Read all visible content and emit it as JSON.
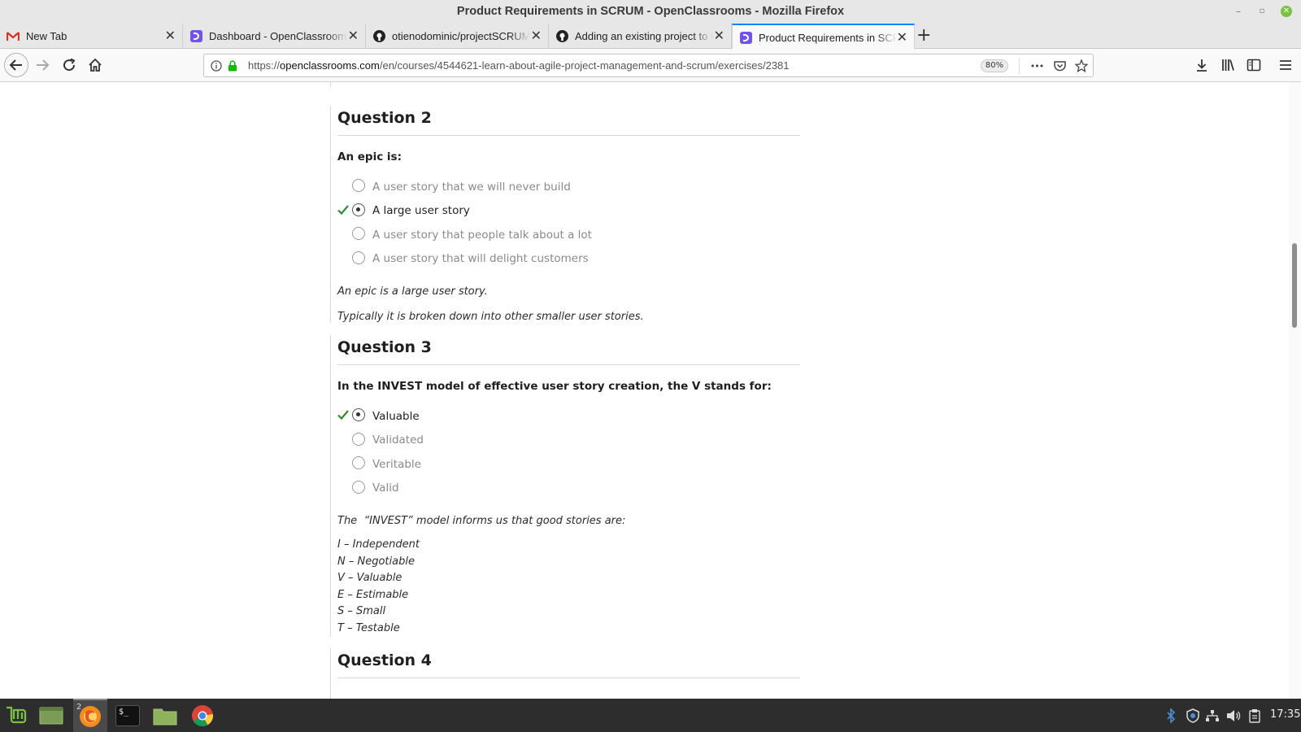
{
  "window": {
    "title": "Product Requirements in SCRUM - OpenClassrooms - Mozilla Firefox",
    "controls": {
      "minimize": "–",
      "maximize": "▫",
      "close": "✕"
    }
  },
  "tabs": [
    {
      "label": "New Tab",
      "icon": "gmail-icon",
      "active": false
    },
    {
      "label": "Dashboard - OpenClassrooms",
      "icon": "openclassrooms-icon",
      "active": false
    },
    {
      "label": "otienodominic/projectSCRUM",
      "icon": "github-icon",
      "active": false
    },
    {
      "label": "Adding an existing project to GitHub",
      "icon": "github-icon",
      "active": false
    },
    {
      "label": "Product Requirements in SCRUM",
      "icon": "openclassrooms-icon",
      "active": true
    }
  ],
  "tab_close_glyph": "✕",
  "new_tab_glyph": "+",
  "navbar": {
    "url_prefix": "https://",
    "url_host": "openclassrooms.com",
    "url_path": "/en/courses/4544621-learn-about-agile-project-management-and-scrum/exercises/2381",
    "zoom": "80%",
    "more_glyph": "•••"
  },
  "questions": [
    {
      "title": "Question 2",
      "prompt": "An epic is:",
      "options": [
        {
          "text": "A user story that we will never build",
          "selected": false,
          "correct": false
        },
        {
          "text": "A large user story",
          "selected": true,
          "correct": true
        },
        {
          "text": "A user story that people talk about a lot",
          "selected": false,
          "correct": false
        },
        {
          "text": "A user story that will delight customers",
          "selected": false,
          "correct": false
        }
      ],
      "explanation": [
        "An epic is a large user story.",
        "Typically it is broken down into other smaller user stories."
      ]
    },
    {
      "title": "Question 3",
      "prompt": "In the INVEST model of effective user story creation, the V stands for:",
      "options": [
        {
          "text": "Valuable",
          "selected": true,
          "correct": true
        },
        {
          "text": "Validated",
          "selected": false,
          "correct": false
        },
        {
          "text": "Veritable",
          "selected": false,
          "correct": false
        },
        {
          "text": "Valid",
          "selected": false,
          "correct": false
        }
      ],
      "explanation": [
        "The  “INVEST” model informs us that good stories are:"
      ],
      "invest_list": [
        "I – Independent",
        "N – Negotiable",
        "V – Valuable",
        "E – Estimable",
        "S – Small",
        "T – Testable"
      ]
    },
    {
      "title": "Question 4"
    }
  ],
  "taskbar": {
    "clock": "17:35",
    "firefox_badge": "2",
    "terminal_glyph": "$_"
  },
  "colors": {
    "accent_blue": "#0a84ff",
    "check_green": "#2e8b2e",
    "mint_green": "#7ac142",
    "openclassrooms_purple": "#7451eb"
  }
}
